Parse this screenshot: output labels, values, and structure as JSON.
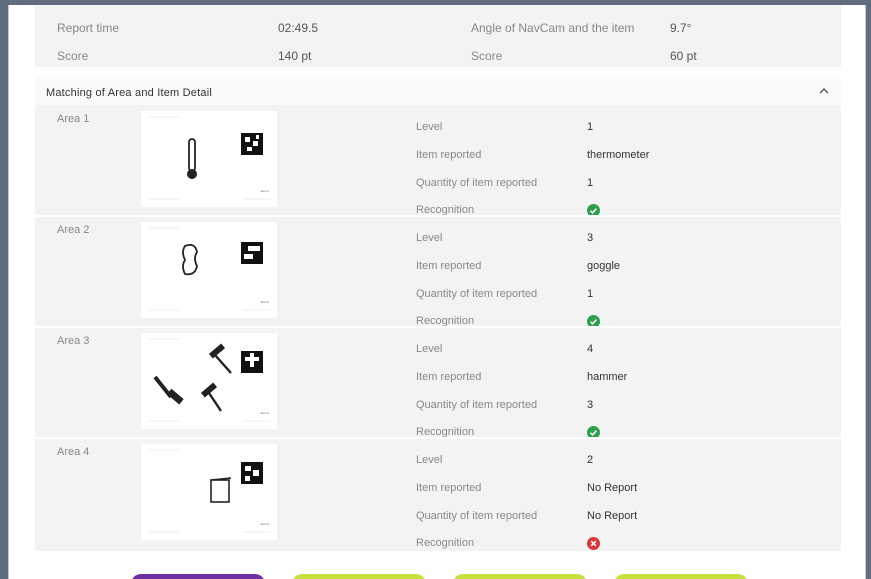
{
  "summary": {
    "left": [
      {
        "label": "Report time",
        "value": "02:49.5"
      },
      {
        "label": "Score",
        "value": "140 pt"
      }
    ],
    "right": [
      {
        "label": "Angle of NavCam and the item",
        "value": "9.7°"
      },
      {
        "label": "Score",
        "value": "60 pt"
      }
    ]
  },
  "detail": {
    "title": "Matching of Area and Item Detail",
    "collapse_icon": "chevron-up-icon",
    "field_labels": {
      "level": "Level",
      "item_reported": "Item reported",
      "quantity": "Quantity of item reported",
      "recognition": "Recognition"
    },
    "areas": [
      {
        "label": "Area 1",
        "image_icon": "thermometer-icon",
        "level": "1",
        "item_reported": "thermometer",
        "quantity": "1",
        "recognition": "success",
        "thumb_caption": "Item 1"
      },
      {
        "label": "Area 2",
        "image_icon": "goggle-icon",
        "level": "3",
        "item_reported": "goggle",
        "quantity": "1",
        "recognition": "success",
        "thumb_caption": "Item 2"
      },
      {
        "label": "Area 3",
        "image_icon": "hammer-icon",
        "level": "4",
        "item_reported": "hammer",
        "quantity": "3",
        "recognition": "success",
        "thumb_caption": "Item 3"
      },
      {
        "label": "Area 4",
        "image_icon": "beaker-icon",
        "level": "2",
        "item_reported": "No Report",
        "quantity": "No Report",
        "recognition": "failure",
        "thumb_caption": "Item 4"
      }
    ]
  },
  "colors": {
    "success": "#2e9e4f",
    "failure": "#d9383a",
    "purple_button": "#6b2fa0",
    "lime_button": "#c9e03a"
  }
}
